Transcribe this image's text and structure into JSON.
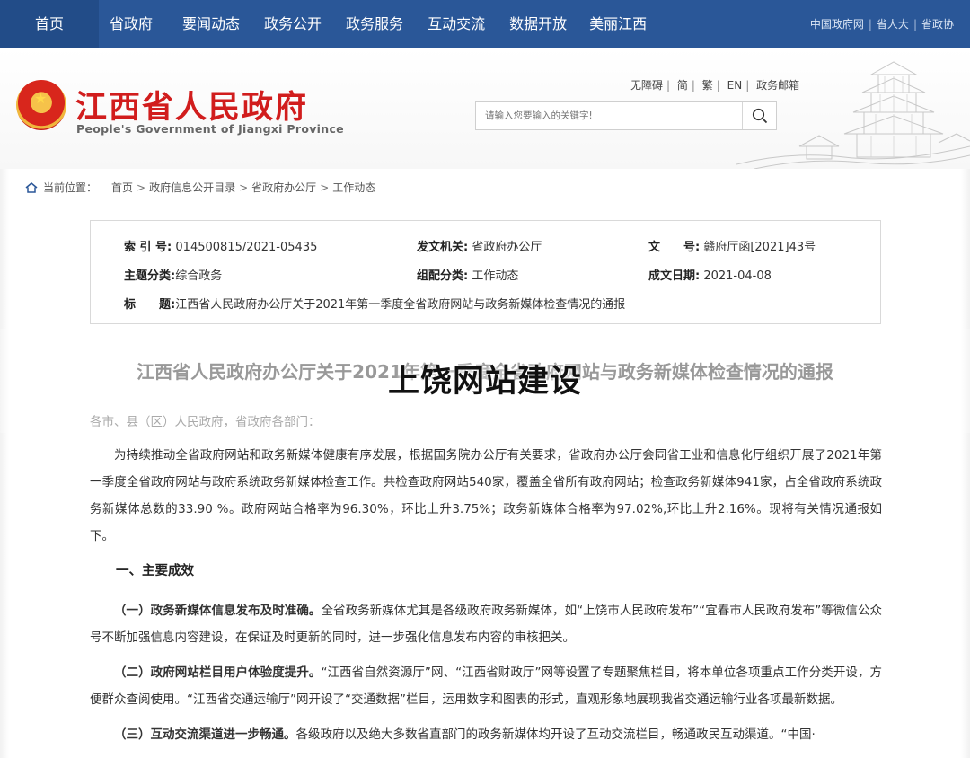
{
  "nav": {
    "items": [
      "首页",
      "省政府",
      "要闻动态",
      "政务公开",
      "政务服务",
      "互动交流",
      "数据开放",
      "美丽江西"
    ],
    "right_links": [
      "中国政府网",
      "省人大",
      "省政协"
    ]
  },
  "header": {
    "title": "江西省人民政府",
    "subtitle": "People's Government of Jiangxi Province",
    "quick_links": [
      "无障碍",
      "简",
      "繁",
      "EN",
      "政务邮箱"
    ],
    "search_placeholder": "请输入您要输入的关键字!"
  },
  "breadcrumb": {
    "label": "当前位置：",
    "items": [
      "首页",
      "政府信息公开目录",
      "省政府办公厅",
      "工作动态"
    ]
  },
  "meta": {
    "index_label": "索 引 号:",
    "index_value": "014500815/2021-05435",
    "issuer_label": "发文机关:",
    "issuer_value": "省政府办公厅",
    "doc_label": "文　　号:",
    "doc_value": "赣府厅函[2021]43号",
    "topic_label": "主题分类:",
    "topic_value": "综合政务",
    "category_label": "组配分类:",
    "category_value": "工作动态",
    "date_label": "成文日期:",
    "date_value": "2021-04-08",
    "title_label": "标　　题:",
    "title_value": "江西省人民政府办公厅关于2021年第一季度全省政府网站与政务新媒体检查情况的通报"
  },
  "article": {
    "title": "江西省人民政府办公厅关于2021年第一季度全省政府网站与政务新媒体检查情况的通报",
    "overlay": "上饶网站建设",
    "addressee": "各市、县（区）人民政府，省政府各部门：",
    "p1": "为持续推动全省政府网站和政务新媒体健康有序发展，根据国务院办公厅有关要求，省政府办公厅会同省工业和信息化厅组织开展了2021年第一季度全省政府网站与政府系统政务新媒体检查工作。共检查政府网站540家，覆盖全省所有政府网站；检查政务新媒体941家，占全省政府系统政务新媒体总数的33.90 %。政府网站合格率为96.30%，环比上升3.75%；政务新媒体合格率为97.02%,环比上升2.16%。现将有关情况通报如下。",
    "h1": "一、主要成效",
    "p2_key": "（一）政务新媒体信息发布及时准确。",
    "p2": "全省政务新媒体尤其是各级政府政务新媒体，如“上饶市人民政府发布”“宜春市人民政府发布”等微信公众号不断加强信息内容建设，在保证及时更新的同时，进一步强化信息发布内容的审核把关。",
    "p3_key": "（二）政府网站栏目用户体验度提升。",
    "p3": "“江西省自然资源厅”网、“江西省财政厅”网等设置了专题聚焦栏目，将本单位各项重点工作分类开设，方便群众查阅使用。“江西省交通运输厅”网开设了“交通数据”栏目，运用数字和图表的形式，直观形象地展现我省交通运输行业各项最新数据。",
    "p4_key": "（三）互动交流渠道进一步畅通。",
    "p4": "各级政府以及绝大多数省直部门的政务新媒体均开设了互动交流栏目，畅通政民互动渠道。“中国·"
  }
}
